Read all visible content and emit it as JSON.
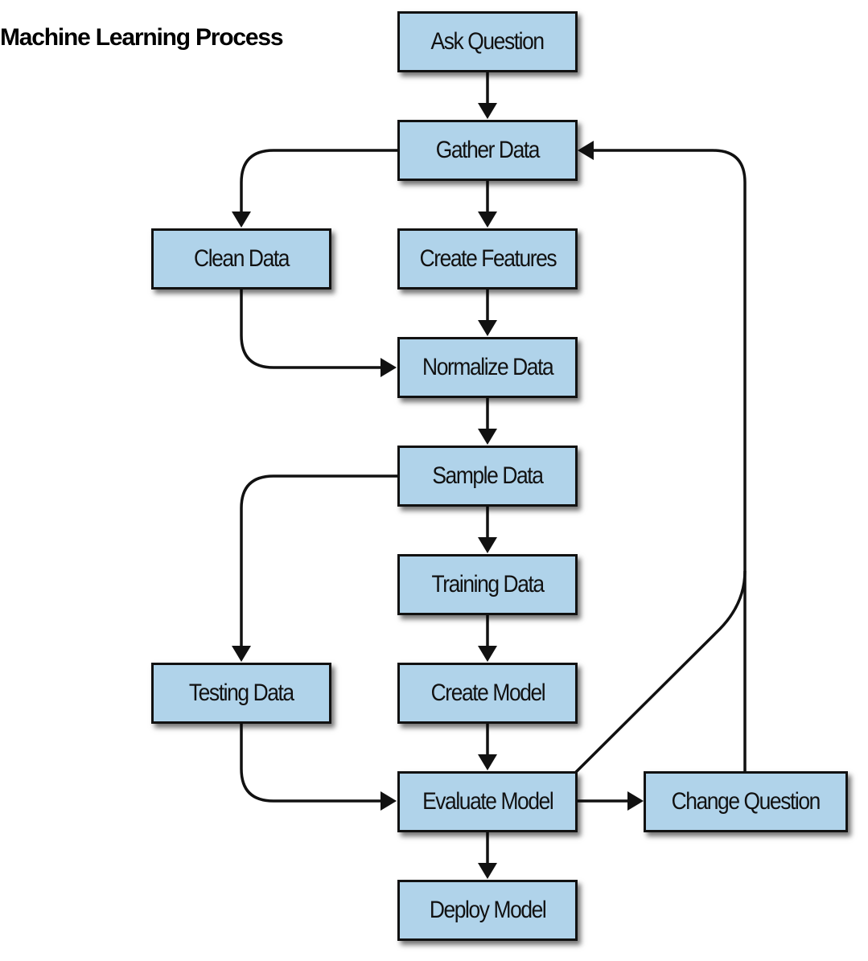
{
  "title": "Machine Learning Process",
  "colors": {
    "box_fill": "#b0d3ea",
    "stroke": "#111111"
  },
  "nodes": {
    "ask_question": "Ask Question",
    "gather_data": "Gather Data",
    "clean_data": "Clean Data",
    "create_features": "Create Features",
    "normalize_data": "Normalize Data",
    "sample_data": "Sample Data",
    "training_data": "Training Data",
    "testing_data": "Testing Data",
    "create_model": "Create Model",
    "evaluate_model": "Evaluate Model",
    "change_question": "Change Question",
    "deploy_model": "Deploy Model"
  },
  "edges": [
    {
      "from": "ask_question",
      "to": "gather_data"
    },
    {
      "from": "gather_data",
      "to": "clean_data"
    },
    {
      "from": "gather_data",
      "to": "create_features"
    },
    {
      "from": "clean_data",
      "to": "normalize_data"
    },
    {
      "from": "create_features",
      "to": "normalize_data"
    },
    {
      "from": "normalize_data",
      "to": "sample_data"
    },
    {
      "from": "sample_data",
      "to": "training_data"
    },
    {
      "from": "sample_data",
      "to": "testing_data"
    },
    {
      "from": "training_data",
      "to": "create_model"
    },
    {
      "from": "create_model",
      "to": "evaluate_model"
    },
    {
      "from": "testing_data",
      "to": "evaluate_model"
    },
    {
      "from": "evaluate_model",
      "to": "change_question"
    },
    {
      "from": "evaluate_model",
      "to": "gather_data"
    },
    {
      "from": "change_question",
      "to": "gather_data"
    },
    {
      "from": "evaluate_model",
      "to": "deploy_model"
    }
  ]
}
